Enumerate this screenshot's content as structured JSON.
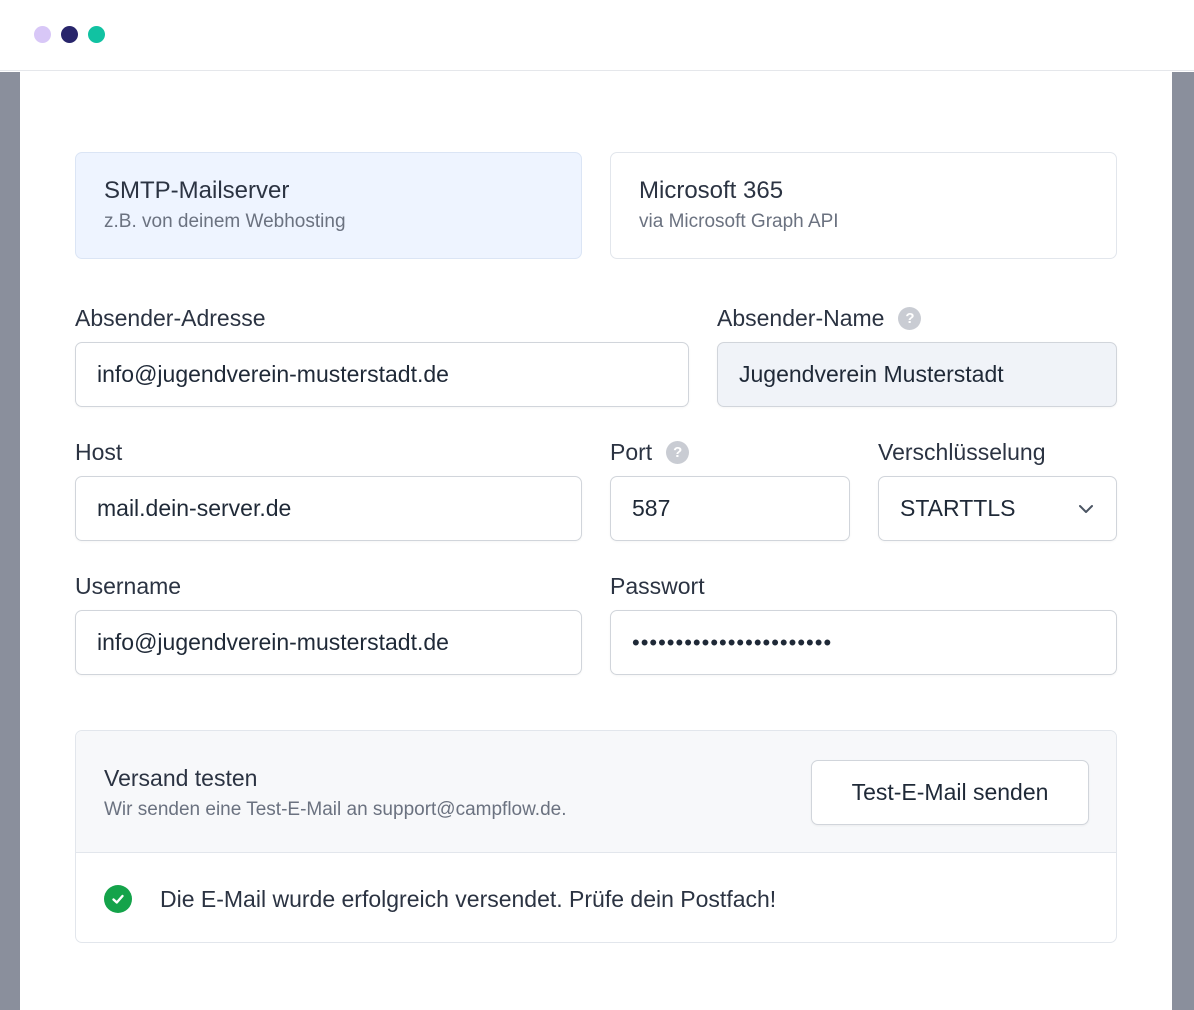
{
  "window": {
    "dots": [
      "#d8c7f7",
      "#28256b",
      "#11c2a2"
    ]
  },
  "provider": {
    "options": [
      {
        "title": "SMTP-Mailserver",
        "subtitle": "z.B. von deinem Webhosting",
        "selected": true
      },
      {
        "title": "Microsoft 365",
        "subtitle": "via Microsoft Graph API",
        "selected": false
      }
    ]
  },
  "form": {
    "sender_address": {
      "label": "Absender-Adresse",
      "value": "info@jugendverein-musterstadt.de"
    },
    "sender_name": {
      "label": "Absender-Name",
      "help": "?",
      "value": "Jugendverein Musterstadt"
    },
    "host": {
      "label": "Host",
      "value": "mail.dein-server.de"
    },
    "port": {
      "label": "Port",
      "help": "?",
      "value": "587"
    },
    "encryption": {
      "label": "Verschlüsselung",
      "value": "STARTTLS"
    },
    "username": {
      "label": "Username",
      "value": "info@jugendverein-musterstadt.de"
    },
    "password": {
      "label": "Passwort",
      "value": "•••••••••••••••••••••••"
    }
  },
  "test": {
    "title": "Versand testen",
    "subtitle": "Wir senden eine Test-E-Mail an support@campflow.de.",
    "button_label": "Test-E-Mail senden",
    "success_message": "Die E-Mail wurde erfolgreich versendet. Prüfe dein Postfach!"
  },
  "colors": {
    "accent_selected": "#eef4ff",
    "success": "#14a34a"
  }
}
